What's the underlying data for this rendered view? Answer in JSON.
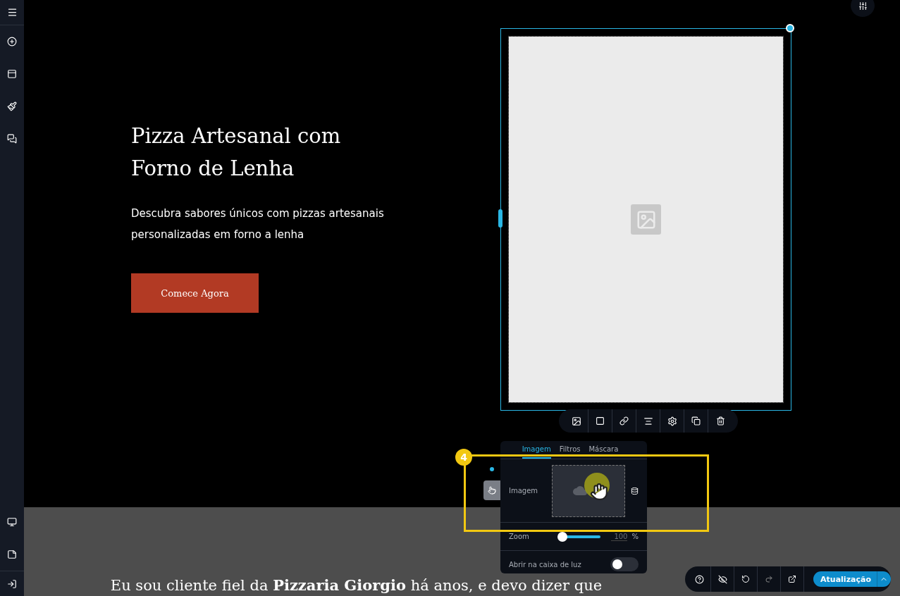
{
  "hero": {
    "title": "Pizza Artesanal com Forno de Lenha",
    "subtitle": "Descubra sabores únicos com pizzas artesanais personalizadas em forno a lenha",
    "button": "Comece Agora"
  },
  "image_panel": {
    "tabs": [
      {
        "label": "Imagem",
        "selected": true
      },
      {
        "label": "Filtros",
        "selected": false
      },
      {
        "label": "Máscara",
        "selected": false
      }
    ],
    "image_label": "Imagem",
    "zoom": {
      "label": "Zoom",
      "level": 0,
      "value": "100",
      "unit": "%"
    },
    "lightbox": {
      "label": "Abrir na caixa de luz",
      "on": false
    }
  },
  "tutorial": {
    "step": "4"
  },
  "testimonial": "Eu sou cliente fiel da **Pizzaria Giorgio** há anos, e devo dizer que",
  "bottom_bar": {
    "publish_button": "Atualização"
  }
}
